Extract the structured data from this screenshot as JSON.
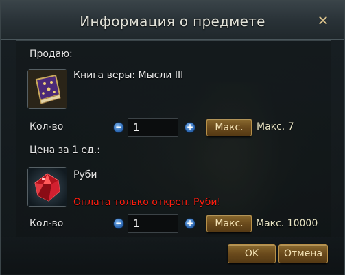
{
  "dialog": {
    "title": "Информация о предмете",
    "close_icon": "close-icon"
  },
  "sell": {
    "label": "Продаю:",
    "item_name": "Книга веры: Мысли III",
    "item_icon": "book-icon",
    "qty_label": "Кол-во",
    "qty_value": "1",
    "max_button": "Макс.",
    "max_text": "Макс. 7"
  },
  "price": {
    "label": "Цена за 1 ед.:",
    "item_name": "Руби",
    "item_icon": "ruby-gem-icon",
    "warning": "Оплата только откреп. Руби!",
    "qty_label": "Кол-во",
    "qty_value": "1",
    "max_button": "Макс.",
    "max_text": "Макс. 10000"
  },
  "buttons": {
    "ok": "OK",
    "cancel": "Отмена"
  },
  "colors": {
    "warning": "#ff1e10",
    "accent_gold": "#b79049",
    "stepper_blue": "#2f6bb5"
  }
}
